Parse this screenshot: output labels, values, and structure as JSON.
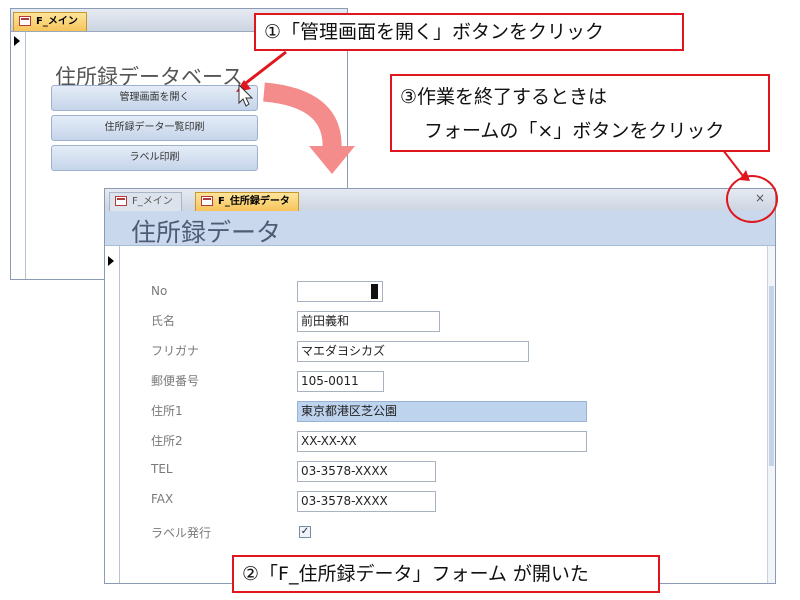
{
  "colors": {
    "callout_border": "#e0161e",
    "big_arrow": "#f48c8c",
    "active_tab": "#f7c45a",
    "header_band": "#c9d8ec",
    "button": "#c6d5ea"
  },
  "main_menu_window": {
    "tab_label": "F_メイン",
    "title": "住所録データベース",
    "buttons": [
      {
        "label": "管理画面を開く"
      },
      {
        "label": "住所録データ一覧印刷"
      },
      {
        "label": "ラベル印刷"
      }
    ]
  },
  "address_form_window": {
    "tabs": [
      {
        "label": "F_メイン",
        "active": false
      },
      {
        "label": "F_住所録データ",
        "active": true
      }
    ],
    "close_label": "×",
    "title": "住所録データ",
    "fields": {
      "no": {
        "label": "No",
        "value": ""
      },
      "name": {
        "label": "氏名",
        "value": "前田義和"
      },
      "furigana": {
        "label": "フリガナ",
        "value": "マエダヨシカズ"
      },
      "postal": {
        "label": "郵便番号",
        "value": "105-0011"
      },
      "address1": {
        "label": "住所1",
        "value": "東京都港区芝公園"
      },
      "address2": {
        "label": "住所2",
        "value": "XX-XX-XX"
      },
      "tel": {
        "label": "TEL",
        "value": "03-3578-XXXX"
      },
      "fax": {
        "label": "FAX",
        "value": "03-3578-XXXX"
      },
      "label_print": {
        "label": "ラベル発行",
        "checked": true,
        "check_glyph": "✓"
      }
    }
  },
  "callouts": {
    "step1": "①「管理画面を開く」ボタンをクリック",
    "step2": "②「F_住所録データ」フォーム が開いた",
    "step3_line1": "③作業を終了するときは",
    "step3_line2": "フォームの「×」ボタンをクリック"
  }
}
